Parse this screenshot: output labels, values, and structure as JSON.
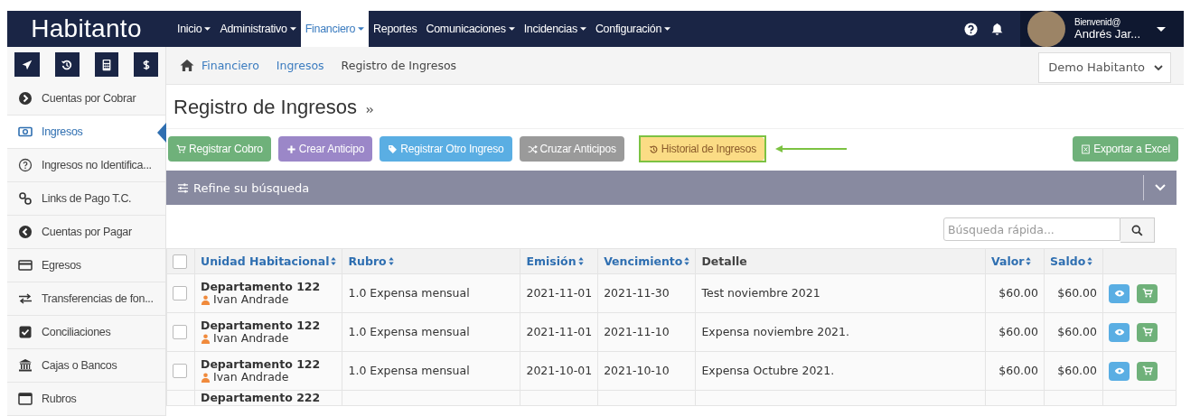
{
  "navbar": {
    "brand": "Habitanto",
    "menu": [
      {
        "label": "Inicio",
        "dropdown": true,
        "selected": false
      },
      {
        "label": "Administrativo",
        "dropdown": true,
        "selected": false
      },
      {
        "label": "Financiero",
        "dropdown": true,
        "selected": true
      },
      {
        "label": "Reportes",
        "dropdown": false,
        "selected": false
      },
      {
        "label": "Comunicaciones",
        "dropdown": true,
        "selected": false
      },
      {
        "label": "Incidencias",
        "dropdown": true,
        "selected": false
      },
      {
        "label": "Configuración",
        "dropdown": true,
        "selected": false
      }
    ],
    "user": {
      "greeting": "Bienvenid@",
      "name": "Andrés Jar..."
    }
  },
  "sidebar": {
    "items": [
      {
        "label": "Cuentas por Cobrar",
        "selected": false
      },
      {
        "label": "Ingresos",
        "selected": true
      },
      {
        "label": "Ingresos no Identifica...",
        "selected": false
      },
      {
        "label": "Links de Pago T.C.",
        "selected": false
      },
      {
        "label": "Cuentas por Pagar",
        "selected": false
      },
      {
        "label": "Egresos",
        "selected": false
      },
      {
        "label": "Transferencias de fon...",
        "selected": false
      },
      {
        "label": "Conciliaciones",
        "selected": false
      },
      {
        "label": "Cajas o Bancos",
        "selected": false
      },
      {
        "label": "Rubros",
        "selected": false
      }
    ]
  },
  "breadcrumb": [
    {
      "label": "Financiero",
      "link": true
    },
    {
      "label": "Ingresos",
      "link": true
    },
    {
      "label": "Registro de Ingresos",
      "link": false
    }
  ],
  "company_select": {
    "value": "Demo Habitanto"
  },
  "page_title": "Registro de Ingresos",
  "actions": [
    {
      "label": "Registrar Cobro",
      "color": "#6fb17a",
      "highlighted": false
    },
    {
      "label": "Crear Anticipo",
      "color": "#9b87c8",
      "highlighted": false
    },
    {
      "label": "Registrar Otro Ingreso",
      "color": "#5aaee3",
      "highlighted": false
    },
    {
      "label": "Cruzar Anticipos",
      "color": "#9a9a9a",
      "highlighted": false
    },
    {
      "label": "Historial de Ingresos",
      "color": "#fbdc85",
      "highlighted": true
    }
  ],
  "export_button": {
    "label": "Exportar a Excel"
  },
  "filter_panel": {
    "title": "Refine su búsqueda",
    "expanded": false
  },
  "search": {
    "placeholder": "Búsqueda rápida..."
  },
  "table": {
    "select_all": {
      "checked": false
    },
    "columns": [
      {
        "label": "Unidad Habitacional",
        "sortable": true
      },
      {
        "label": "Rubro",
        "sortable": true
      },
      {
        "label": "Emisión",
        "sortable": true
      },
      {
        "label": "Vencimiento",
        "sortable": true
      },
      {
        "label": "Detalle",
        "sortable": false
      },
      {
        "label": "Valor",
        "sortable": true
      },
      {
        "label": "Saldo",
        "sortable": true
      }
    ],
    "rows": [
      {
        "checked": false,
        "unit": "Departamento 122",
        "owner": "Ivan Andrade",
        "rubro": "1.0 Expensa mensual",
        "emision": "2021-11-01",
        "vencimiento": "2021-11-30",
        "detalle": "Test noviembre 2021",
        "valor": "$60.00",
        "saldo": "$60.00"
      },
      {
        "checked": false,
        "unit": "Departamento 122",
        "owner": "Ivan Andrade",
        "rubro": "1.0 Expensa mensual",
        "emision": "2021-11-01",
        "vencimiento": "2021-11-10",
        "detalle": "Expensa noviembre 2021.",
        "valor": "$60.00",
        "saldo": "$60.00"
      },
      {
        "checked": false,
        "unit": "Departamento 122",
        "owner": "Ivan Andrade",
        "rubro": "1.0 Expensa mensual",
        "emision": "2021-10-01",
        "vencimiento": "2021-10-10",
        "detalle": "Expensa Octubre 2021.",
        "valor": "$60.00",
        "saldo": "$60.00"
      },
      {
        "unit": "Departamento 222"
      }
    ]
  }
}
